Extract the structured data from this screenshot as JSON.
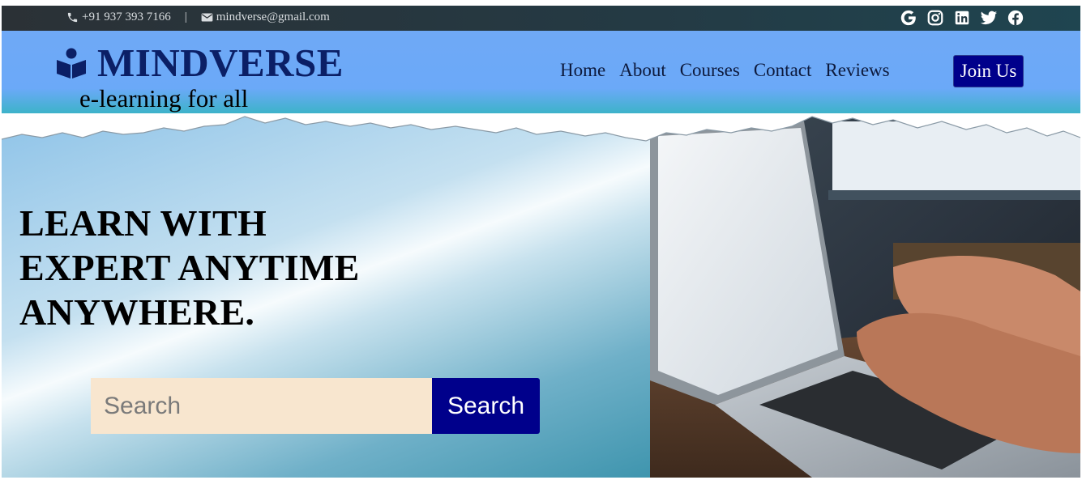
{
  "topbar": {
    "phone": "+91 937 393 7166",
    "separator": "|",
    "email": "mindverse@gmail.com",
    "social_icons": [
      "google-icon",
      "instagram-icon",
      "linkedin-icon",
      "twitter-icon",
      "facebook-icon"
    ]
  },
  "header": {
    "brand": "MINDVERSE",
    "tagline": "e-learning for all",
    "nav": [
      "Home",
      "About",
      "Courses",
      "Contact",
      "Reviews"
    ],
    "cta": "Join Us"
  },
  "hero": {
    "headline_lines": [
      "LEARN WITH",
      "EXPERT ANYTIME",
      "ANYWHERE."
    ],
    "search_placeholder": "Search",
    "search_button": "Search"
  },
  "colors": {
    "brand": "#0b1f66",
    "button": "#00008b",
    "header_bg": "#6ba9f8",
    "search_bg": "#f8e6cf"
  }
}
